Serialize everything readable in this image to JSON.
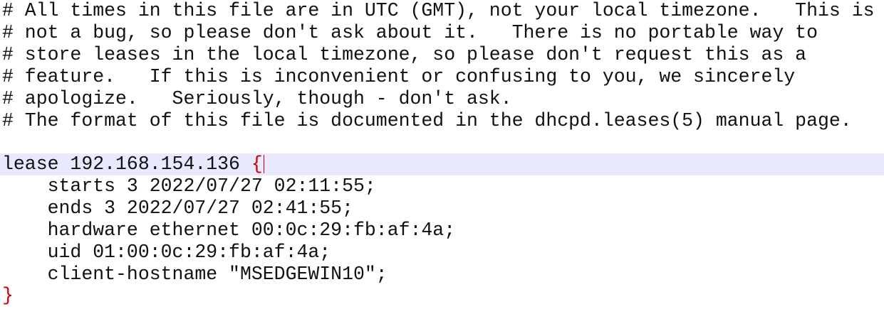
{
  "editor": {
    "comment_lines": [
      "# All times in this file are in UTC (GMT), not your local timezone.   This is",
      "# not a bug, so please don't ask about it.   There is no portable way to",
      "# store leases in the local timezone, so please don't request this as a",
      "# feature.   If this is inconvenient or confusing to you, we sincerely",
      "# apologize.   Seriously, though - don't ask.",
      "# The format of this file is documented in the dhcpd.leases(5) manual page."
    ],
    "lease_header": "lease 192.168.154.136 ",
    "open_brace": "{",
    "body_lines": [
      "    starts 3 2022/07/27 02:11:55;",
      "    ends 3 2022/07/27 02:41:55;",
      "    hardware ethernet 00:0c:29:fb:af:4a;",
      "    uid 01:00:0c:29:fb:af:4a;",
      "    client-hostname \"MSEDGEWIN10\";"
    ],
    "close_brace": "}",
    "colors": {
      "text": "#111111",
      "brace": "#cc0000",
      "current_line": "#e8e8ff",
      "background": "#ffffff"
    }
  }
}
